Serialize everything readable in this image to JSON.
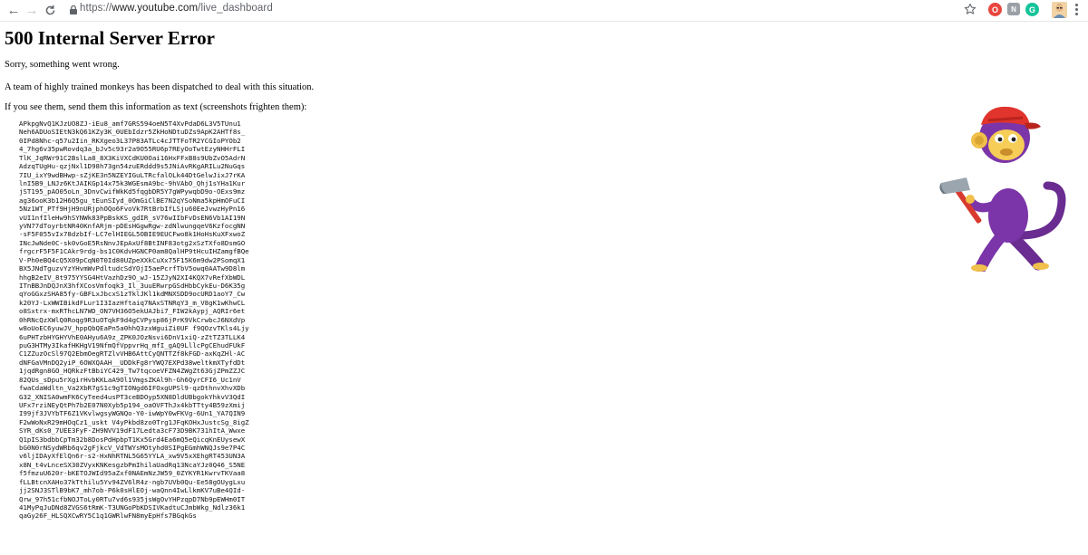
{
  "browser": {
    "url_protocol": "https://",
    "url_host": "www.youtube.com",
    "url_path": "/live_dashboard",
    "back_glyph": "←",
    "forward_glyph": "→",
    "reload_glyph": "C",
    "extensions": [
      "O",
      "N",
      "G"
    ],
    "accent_colors": {
      "red": "#e8453c",
      "green": "#15c39a",
      "gray": "#9aa0a6"
    }
  },
  "page": {
    "title": "500 Internal Server Error",
    "line1": "Sorry, something went wrong.",
    "line2": "A team of highly trained monkeys has been dispatched to deal with this situation.",
    "line3": "If you see them, send them this information as text (screenshots frighten them):",
    "debug_blob": "APkpgNvQ1KJzUO8ZJ-iEu8_amf7GRS594oeN5T4XvPdaD6L3V5TUnu1\nNeh6ADUoSIEtN3kQ61KZy3K_0UEbIdzr5ZkHoNDtuDZs9ApK2AHTf8s_\n0IPd8Nhc-q57u2Iin_RKXgeo3L37P83ATLc4cJTTFoTR2YCGIoPYOb2\n4_7hg6v35pwRovdq3a_bJv5c93r2a9O55RU6p7REyOoTwtEzyNHHrFLI\nTlK_JqRWr91C2BslLa8_8X3KiVXCdKU0Oai16HxFFxB8s9UbZvO5AdrN\nAdzqTUgHu-qzjNxl1D98h73gn54zuERddd9s5JNiAvRKgARILu2NuGqs\n7IU_ixY9wdBHwp-sZjKE3n5NZEYIGuLTRcfalOLk44DtGelwJixJ7rKA\nlnI5B9_LNJz6KtJAIKGp14x75k3WGEsmA9bc-9hVAbO_Qhj1sYHa1Kur\njST195_pAO05oLn_3DnvCwifWkKd5fqgbDR5Y7gWPywqbD9o-OExs9mz\nag36ooK3b12H6Q5gu_tEunSIyd_0OmGiClBE7N2qYSoNma5kpHmOFuCI\n5Nz1WT_PTf9HjH9nURjphOQo6FvoVk7RtBrbIfLSju60EeJvwzHyPn16\nvUI1nfIleHw9hSYNWk83PpBskKS_gdIR_sV76wIIbFvDsEN6Vb1AI19N\nyVN77dToyrbtNR40KnfARjm-pDEsHGgwRgw-zdNlwungqeV6KzfocgNN\n-sF5F055vIx78dzbIf-LC7elHIEGL5OBIE9EUCFwo8k1HoHsKuXFxwoZ\nINcJwNde0C-sk0vGoE5RsNnvJEpAxUf8BtINF83otg2xSzTXfo8DsmGO\nfrgcrF5F5F1CAkr9rdg-bs1C0KdvHGNCP0am8QalHP9tHcuIHZamgfBQe\nV-Ph0eBQ4cQ5X09pCqN0T0Id80UZpeXXkCuXx75F15K6m9dw2PSomqX1\nBX5JNdTguzvYzYHvmWvPdltudcSdYOjI5aePcrfTbV5owq0AATw9D8lm\nhhgB2eIV_8t975YYSG4HtVazhDz9O_wJ-15ZJyN2XI4KQX7vRefXbWDL\nITnBBJnDQJnX3hfXCosVmfoqk3_Il_3uuERwrpGSdHbbCykEu-D6K35g\nqYoGGxzSHA85fy-GBFLxJbcxS1zTklJKl1kdMNXSDD9ocURD1aoY7_Cw\nk20YJ-LxWWIBikdFLur1I3IazHftaiq7NAxSTNRqY3_m_V8gK1wKhwCL\no8Sxtrx-mxRThcLN7WD_ON7VH36O5ekUAJbi7_FIW2kAypj_AQRIr6et\n0hRNcQzXWlQ0Roqg9R3uOTqkF9d4gCVPysp86jPrK9VkCrwbcJ6NXdVp\nw8oUoEC6yuwJV_hppQbQEaPn5a0hhQ3zxWguiZi0UF f9QOzvTKls4Ljy\n6uPHTzbHYGHYVhE0AHyu6A9z_ZPK0JOzNsvi6DnV1xiQ-zZtTZ3TLLK4\npuG3HTMy3IkafHKHgV19NfmQfVppvrHq_mfI_gAQ9LllcPgCEhudFUkF\nC1ZZuzOcSl97Q2EbmOegRTZlvVHB6AttCyQNTTZf8kFGD-axKqZHl-AC\ndNFGaVMnDQ2yiP_6OWXQAAH__UDDkFg8rYWQ7EXPd38weltkmXTyfdDt\n1jqdRgn8GO_HQRkzFtBbiYC429_Tw7tqcoeVFZN4ZWgZt63GjZPmZZJC\n82QUs_sDpu5rXgirHvbKKLaA9Ol1VmgsZKAl9h-Gh6QyrCFI6_Uc1nV\nfwaCdaWdltn_Va2XbR7gS1c9gTIONgd6IFOxgUPSl9-qzDthnvXhvXDb\nG32_XNISA0wmFK6CyTeed4usPT3ceBDOyp5XN8DldUBbgokYhkvV3QdI\nUFx7rziNEyQtPh7b2E07N0Xyb5p194_oaOVFThJx4kbTTty4B59zXmij\nI99jf3JVYbTF6Z1VKvlwgsyWGNQo-Y0-iwWpY0wFKVg-6Un1_YA7QIN9\nF2wWoNxR29mHOqCz1_uskt V4yPkbd8zo0Trg1JFqKOHxJustcSg_8igZ\nSYR_dKs0_7UEE3FyF-ZH9NVV19dF17Ledta3cF73D9BK731hItA_Wwxe\nQ1pIS3bdbbCpTm32b8DosPdHpbpT1Kx5Grd4Ea6mQ5eQicqKnEUysewX\nbG0N0rNSydWRb6qv2gFjkcV_VdTWYsMOtyhd0SIPgEGmhWNQJs9e7P4C\nv6ljIDAyXfElQn6r-s2-HxNhRTNL5G65YYLA_xw9V5xXEhgRT453UN3A\nx8N_t4vLnceSX30ZVyxKNKesgzbPmIhilaUadRq13NcaYJz0Q46_S5NE\nf5fmzuU620r-bKETOJWId95aZxf0NAEmNzJW59_0ZYKYR1KwrvTKVaa8\nfLLBtcnXAHo37kTthilu5Yv94ZV6lR4z-ngb7UVb0Qu-Ee58gOUygLxu\njj2SNJ3STlB9bK7_mh7ob-P6k0sHlEOj-waQnn4IwLlkmKV7uBe4QId-\nQrw_97h51cfbNOJToLy0RTu7vd6s935jsWgOvYHPzqpD7Nb9pEWHm0IT\n41MyPqJuDNd8ZVGS6tRmK-T3UNGoPbKDSIVKadtuCJmbWkg_Ndlz36k1\nqaGy26F_HLSQXCwRY5C1q1GWRlwFN8myEpHfs7BGqkGs"
  }
}
